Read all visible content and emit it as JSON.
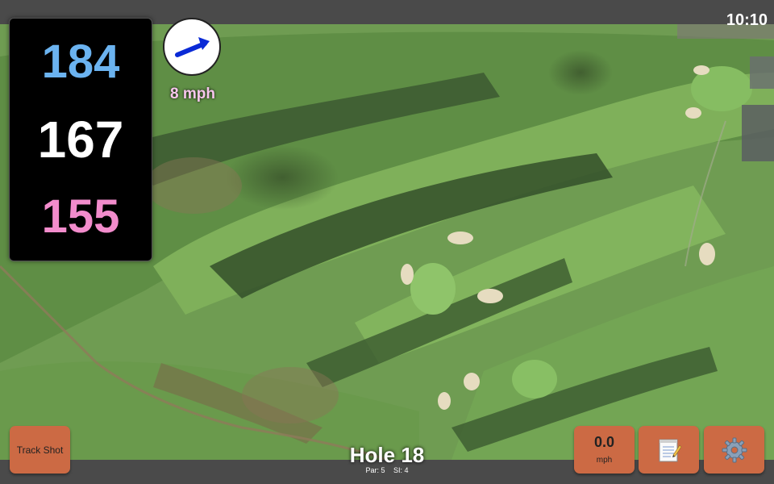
{
  "status_bar": {
    "time": "10:10"
  },
  "distances": {
    "back": "184",
    "middle": "167",
    "front": "155"
  },
  "wind": {
    "speed": "8 mph",
    "icon": "wind-arrow-icon"
  },
  "hole": {
    "title": "Hole 18",
    "par": "Par: 5",
    "si": "SI: 4"
  },
  "buttons": {
    "track_shot": "Track Shot",
    "speed_value": "0.0",
    "speed_unit": "mph",
    "notes_icon": "notepad-icon",
    "settings_icon": "gear-icon"
  },
  "colors": {
    "back": "#6bb3f0",
    "middle": "#ffffff",
    "front": "#f28ccc",
    "button": "#cc6a44",
    "wind_arrow": "#0a2ad6"
  }
}
